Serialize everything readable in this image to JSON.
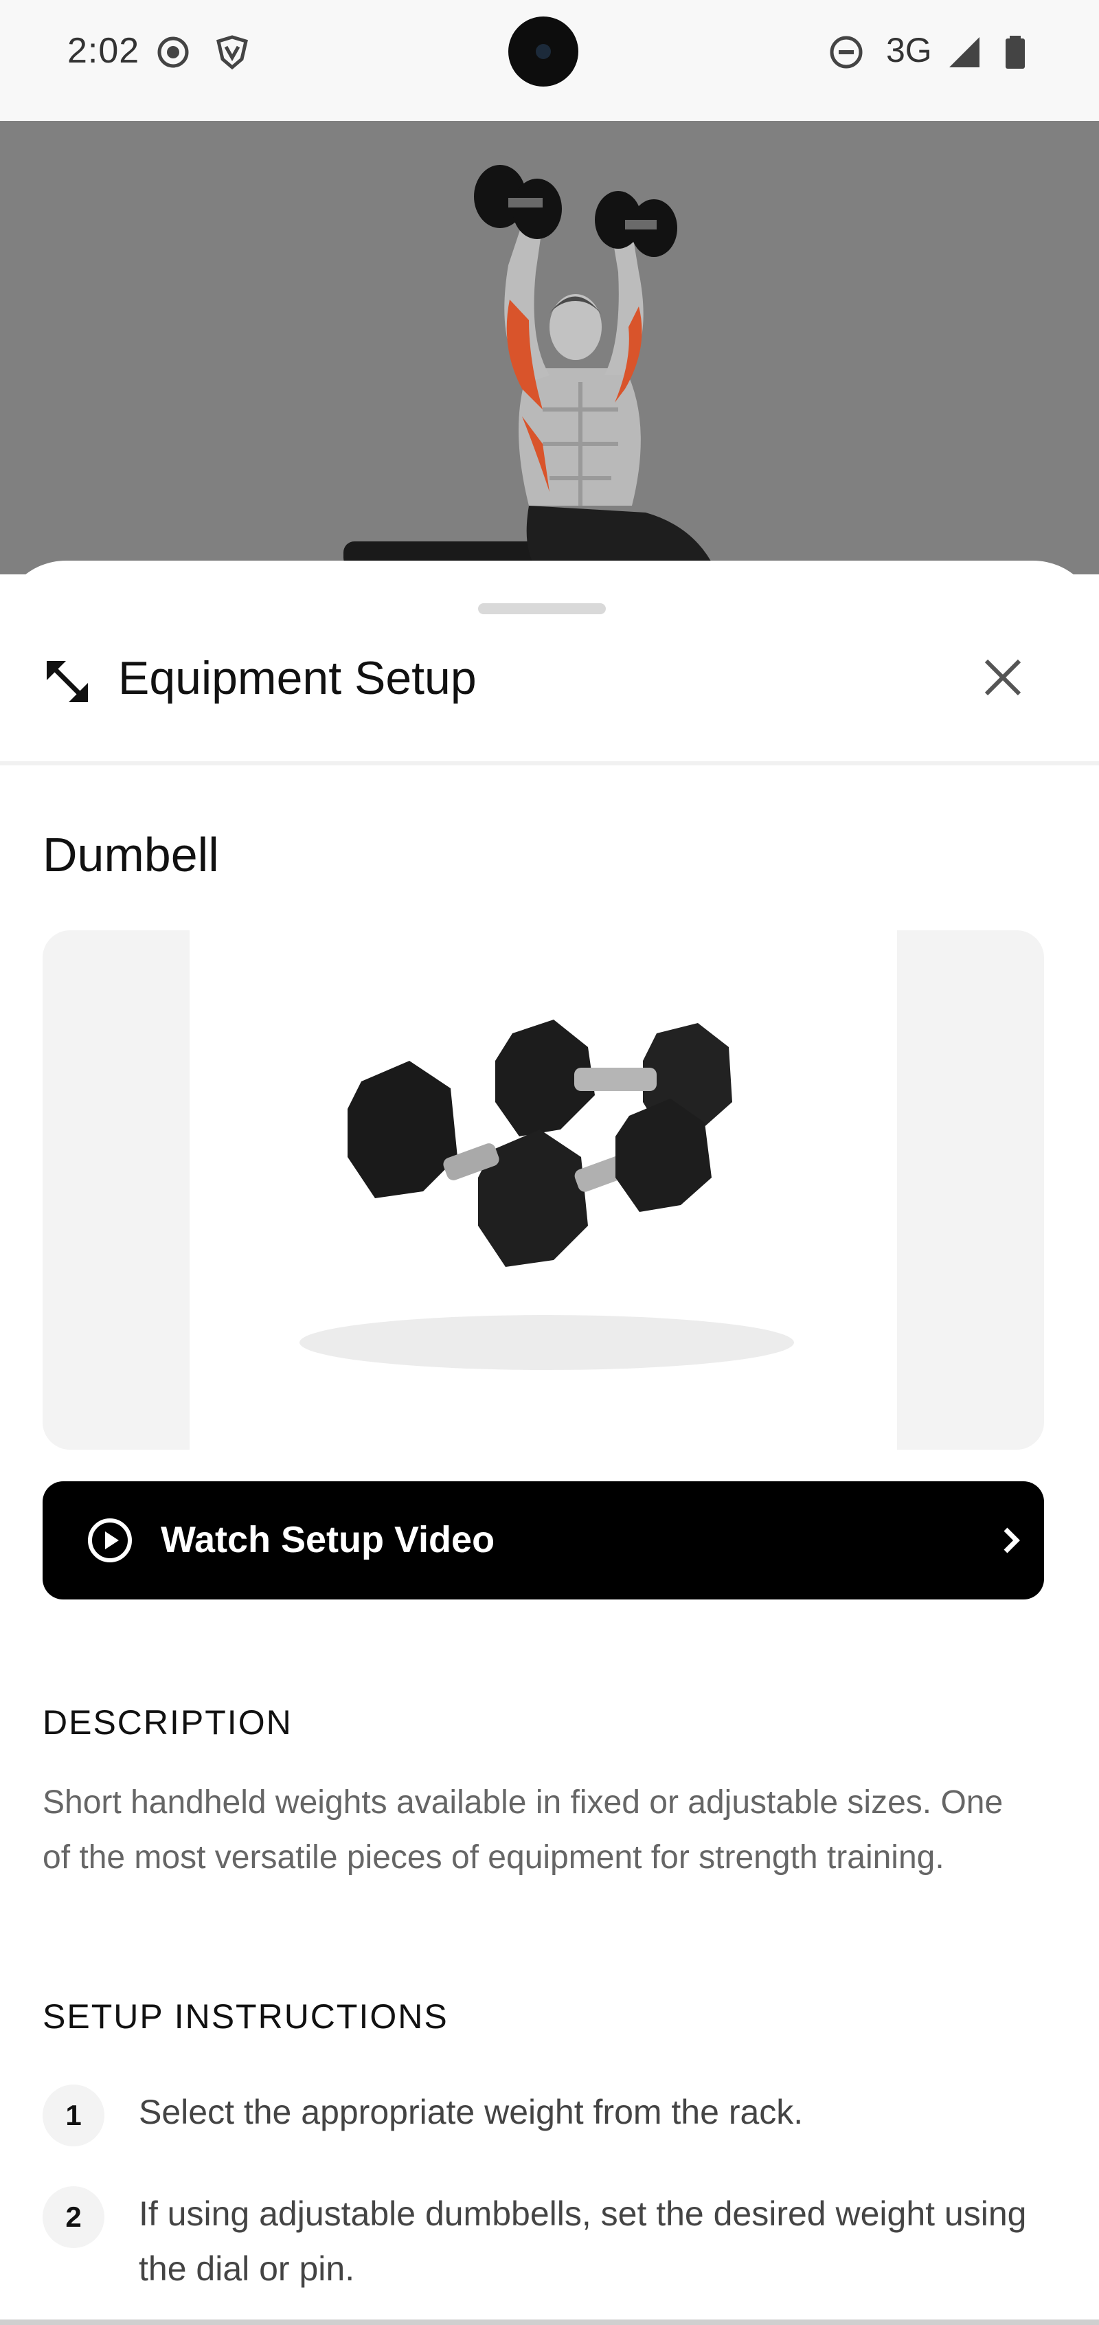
{
  "status_bar": {
    "time": "2:02",
    "network": "3G",
    "icons": [
      "screen-record-icon",
      "vpn-shield-icon",
      "do-not-disturb-icon",
      "signal-icon",
      "battery-icon"
    ]
  },
  "sheet": {
    "title": "Equipment Setup",
    "equipment_name": "Dumbell",
    "watch_video_label": "Watch Setup Video",
    "description_title": "DESCRIPTION",
    "description_text": "Short handheld weights available in fixed or adjustable sizes. One of the most versatile pieces of equipment for strength training.",
    "instructions_title": "SETUP INSTRUCTIONS",
    "steps": [
      {
        "number": "1",
        "text": "Select the appropriate weight from the rack."
      },
      {
        "number": "2",
        "text": "If using adjustable dumbbells, set the desired weight using the dial or pin."
      }
    ]
  },
  "colors": {
    "accent": "#000000",
    "hero_background": "#808080",
    "muscle_highlight": "#d9542b",
    "text_secondary": "#666666"
  }
}
